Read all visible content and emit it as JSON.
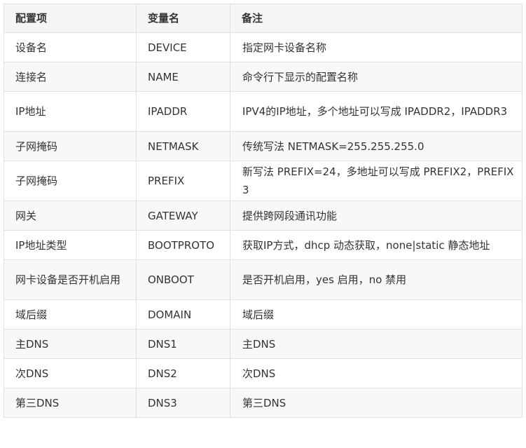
{
  "table": {
    "headers": [
      "配置项",
      "变量名",
      "备注"
    ],
    "rows": [
      [
        "设备名",
        "DEVICE",
        "指定网卡设备名称"
      ],
      [
        "连接名",
        "NAME",
        "命令行下显示的配置名称"
      ],
      [
        "IP地址",
        "IPADDR",
        "IPV4的IP地址，多个地址可以写成 IPADDR2，IPADDR3"
      ],
      [
        "子网掩码",
        "NETMASK",
        "传统写法 NETMASK=255.255.255.0"
      ],
      [
        "子网掩码",
        "PREFIX",
        "新写法 PREFIX=24，多地址可以写成 PREFIX2，PREFIX3"
      ],
      [
        "网关",
        "GATEWAY",
        "提供跨网段通讯功能"
      ],
      [
        "IP地址类型",
        "BOOTPROTO",
        "获取IP方式，dhcp 动态获取，none|static 静态地址"
      ],
      [
        "网卡设备是否开机启用",
        "ONBOOT",
        "是否开机启用，yes 启用，no 禁用"
      ],
      [
        "域后缀",
        "DOMAIN",
        "域后缀"
      ],
      [
        "主DNS",
        "DNS1",
        "主DNS"
      ],
      [
        "次DNS",
        "DNS2",
        "次DNS"
      ],
      [
        "第三DNS",
        "DNS3",
        "第三DNS"
      ]
    ]
  }
}
